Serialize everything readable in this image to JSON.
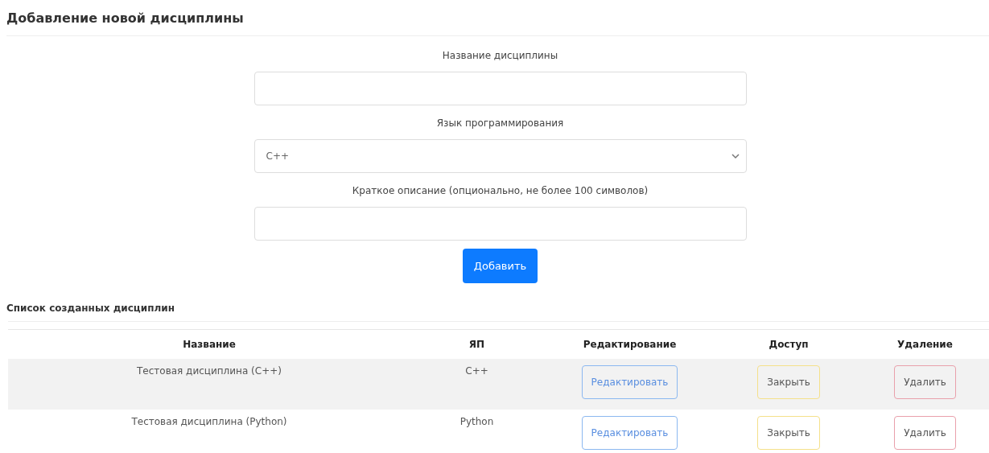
{
  "page_title": "Добавление новой дисциплины",
  "form": {
    "fields": [
      {
        "kind": "input",
        "label": "Название дисциплины"
      },
      {
        "kind": "select",
        "label": "Язык программирования",
        "value": "C++"
      },
      {
        "kind": "input",
        "label": "Краткое описание (опционально, не более 100 символов)"
      }
    ],
    "submit": "Добавить"
  },
  "list_title": "Список созданных дисциплин",
  "table": {
    "columns": [
      "Название",
      "ЯП",
      "Редактирование",
      "Доступ",
      "Удаление"
    ],
    "rows": [
      {
        "name": "Тестовая дисциплина (C++)",
        "language": "C++",
        "actions": [
          {
            "kind": "primary",
            "label": "Редактировать"
          },
          {
            "kind": "warning",
            "label": "Закрыть"
          },
          {
            "kind": "danger",
            "label": "Удалить"
          }
        ]
      },
      {
        "name": "Тестовая дисциплина (Python)",
        "language": "Python",
        "actions": [
          {
            "kind": "primary",
            "label": "Редактировать"
          },
          {
            "kind": "warning",
            "label": "Закрыть"
          },
          {
            "kind": "danger",
            "label": "Удалить"
          }
        ]
      }
    ]
  }
}
